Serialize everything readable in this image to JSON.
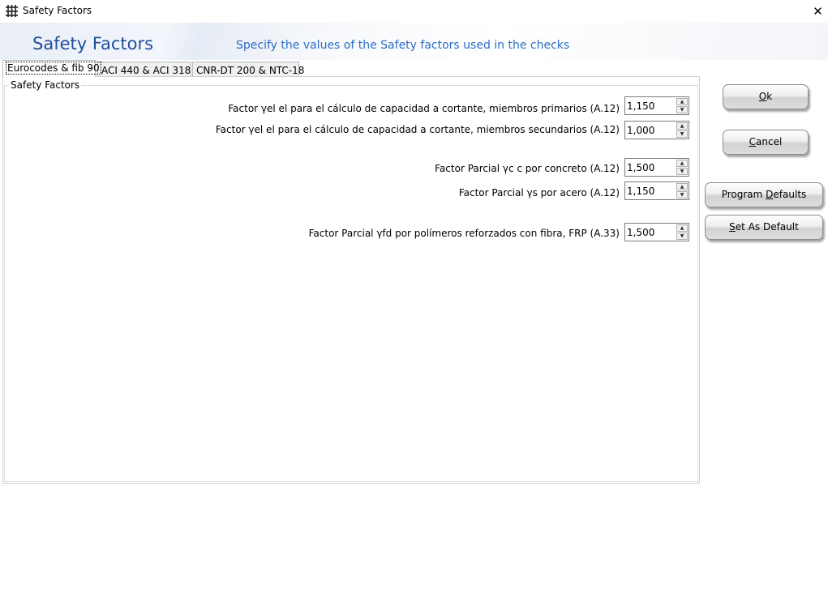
{
  "window": {
    "title": "Safety Factors",
    "icon": "grid-app-icon",
    "close_glyph": "✕"
  },
  "banner": {
    "title": "Safety Factors",
    "subtitle": "Specify the values of the Safety factors used in the checks"
  },
  "tabs": [
    {
      "label": "Eurocodes & fib 90",
      "active": true
    },
    {
      "label": "ACI 440 & ACI 318",
      "active": false
    },
    {
      "label": "CNR-DT 200 & NTC-18",
      "active": false
    }
  ],
  "group": {
    "legend": "Safety Factors"
  },
  "fields": [
    {
      "label": "Factor γel el para el cálculo de capacidad a cortante, miembros primarios (A.12)",
      "value": "1,150"
    },
    {
      "label": "Factor γel el para el cálculo de capacidad a cortante, miembros secundarios (A.12)",
      "value": "1,000"
    },
    {
      "label": "Factor Parcial γc c por concreto (A.12)",
      "value": "1,500"
    },
    {
      "label": "Factor Parcial γs por acero (A.12)",
      "value": "1,150"
    },
    {
      "label": "Factor Parcial γfd por polímeros reforzados con fibra, FRP (A.33)",
      "value": "1,500"
    }
  ],
  "spin_glyphs": {
    "up": "▲",
    "down": "▼"
  },
  "buttons": {
    "ok": {
      "pre": "",
      "mnemonic": "O",
      "post": "k"
    },
    "cancel": {
      "pre": "",
      "mnemonic": "C",
      "post": "ancel"
    },
    "program_defaults": {
      "pre": "Program ",
      "mnemonic": "D",
      "post": "efaults"
    },
    "set_as_default": {
      "pre": "",
      "mnemonic": "S",
      "post": "et As Default"
    }
  }
}
